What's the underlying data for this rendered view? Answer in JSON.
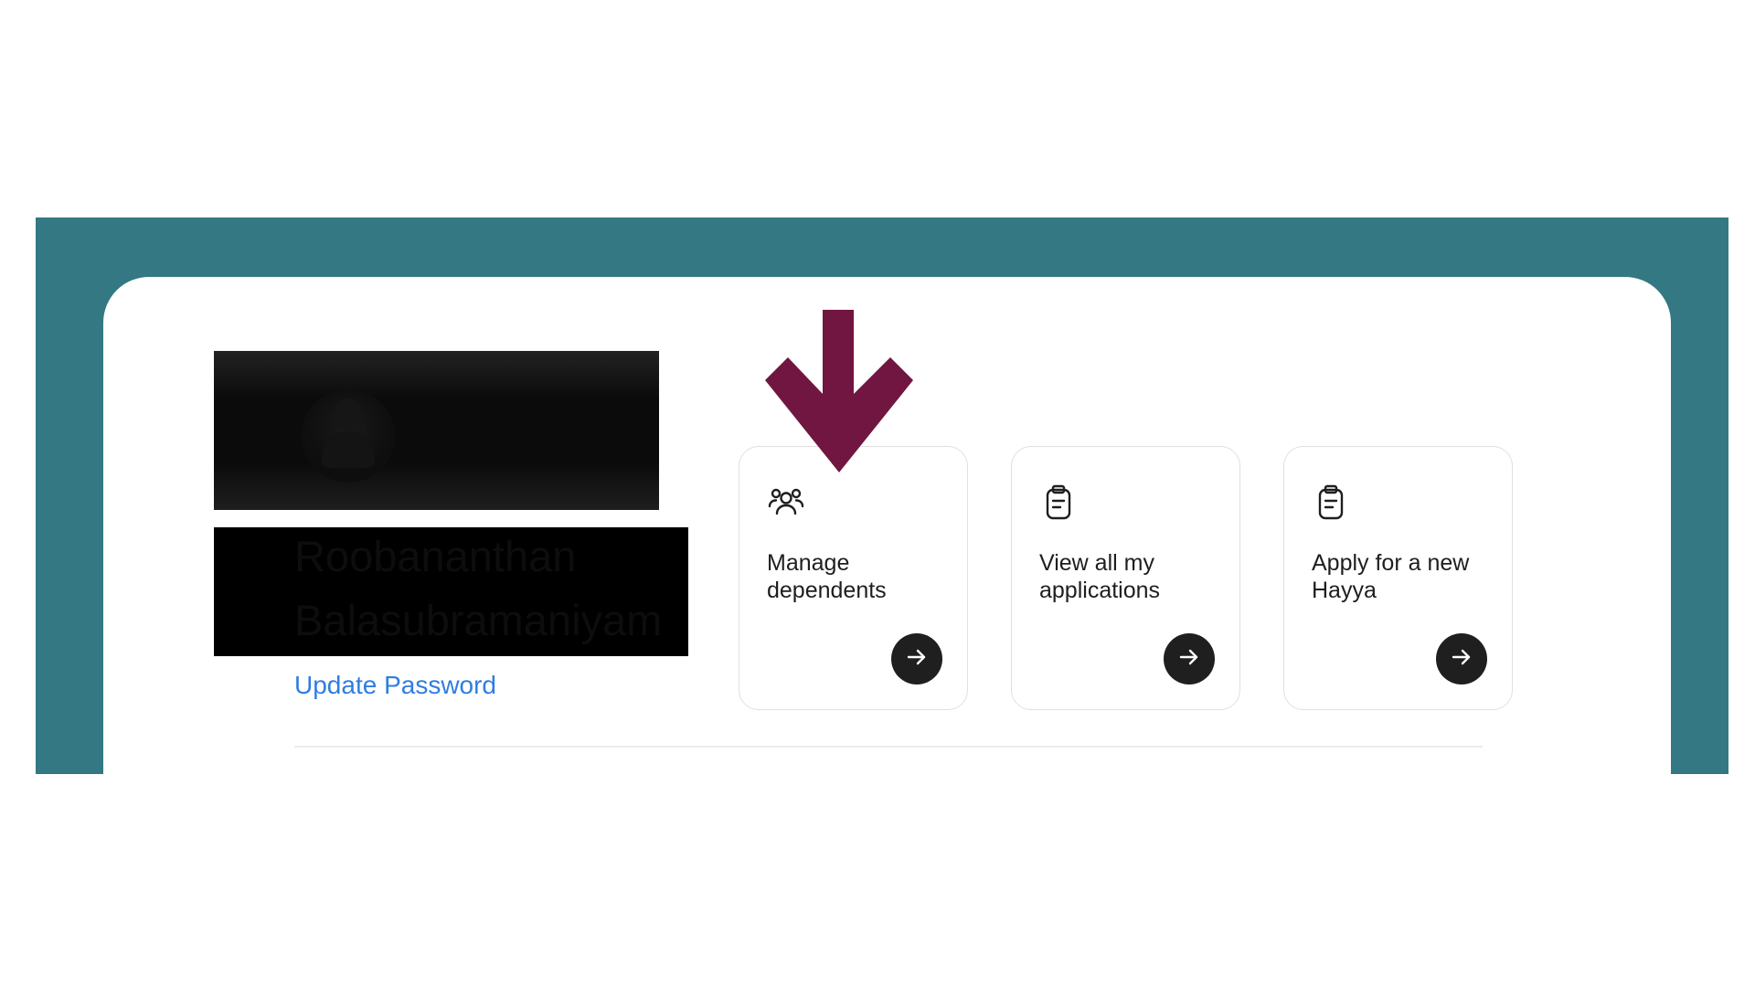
{
  "profile": {
    "name_first": "Roobananthan",
    "name_last": "Balasubramaniyam",
    "update_password_label": "Update Password"
  },
  "cards": [
    {
      "label": "Manage dependents",
      "icon": "users-icon"
    },
    {
      "label": "View all my applications",
      "icon": "clipboard-icon"
    },
    {
      "label": "Apply for a new Hayya",
      "icon": "clipboard-icon"
    }
  ],
  "colors": {
    "teal_band": "#337882",
    "link_blue": "#2f7de1",
    "annotation_arrow": "#711640",
    "arrow_button": "#1f1f1f"
  }
}
